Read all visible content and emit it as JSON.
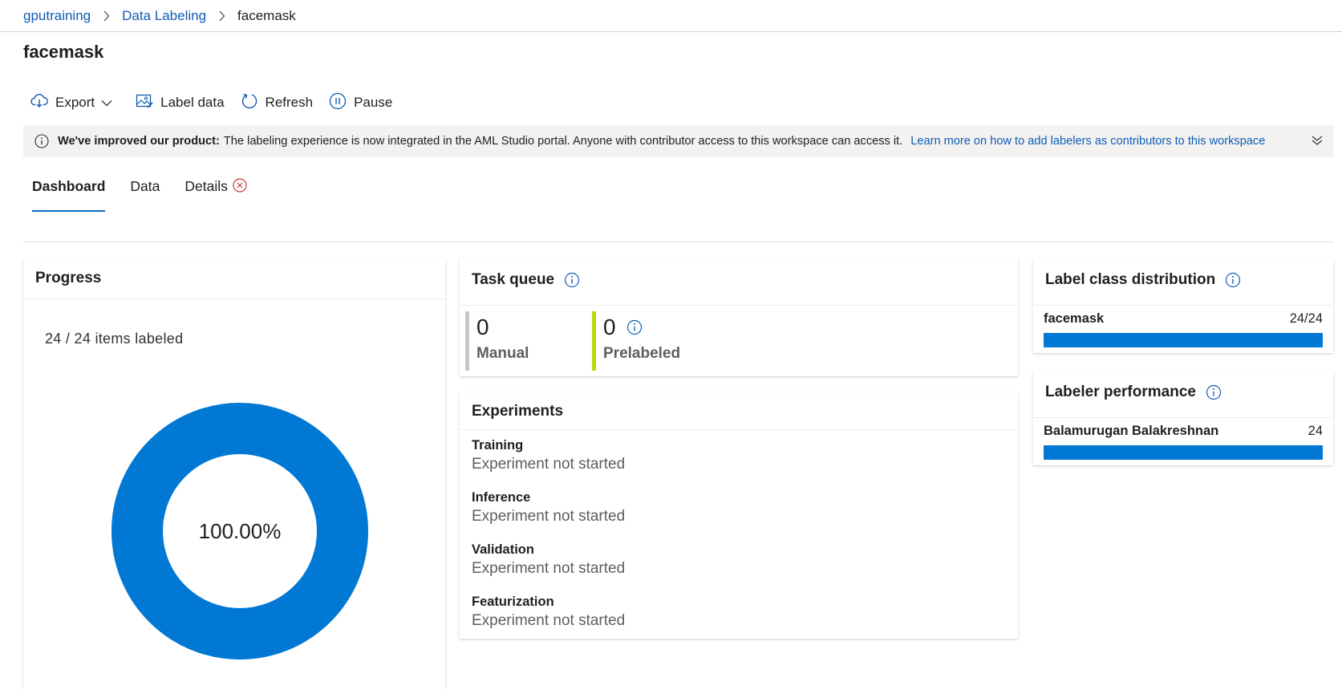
{
  "breadcrumb": {
    "items": [
      "gputraining",
      "Data Labeling"
    ],
    "current": "facemask"
  },
  "page": {
    "title": "facemask"
  },
  "toolbar": {
    "export": "Export",
    "label_data": "Label data",
    "refresh": "Refresh",
    "pause": "Pause"
  },
  "banner": {
    "bold": "We've improved our product:",
    "message": "The labeling experience is now integrated in the AML Studio portal. Anyone with contributor access to this workspace can access it.",
    "link": "Learn more on how to add labelers as contributors to this workspace"
  },
  "tabs": [
    "Dashboard",
    "Data",
    "Details"
  ],
  "progress": {
    "title": "Progress",
    "count_text": "24 / 24 items labeled",
    "percent_text": "100.00%",
    "fraction": 1.0,
    "color": "#0078d4"
  },
  "task_queue": {
    "title": "Task queue",
    "manual": {
      "value": "0",
      "label": "Manual",
      "color": "#c8c6c4"
    },
    "prelabeled": {
      "value": "0",
      "label": "Prelabeled",
      "color": "#bad80a"
    }
  },
  "experiments": {
    "title": "Experiments",
    "items": [
      {
        "name": "Training",
        "status": "Experiment not started"
      },
      {
        "name": "Inference",
        "status": "Experiment not started"
      },
      {
        "name": "Validation",
        "status": "Experiment not started"
      },
      {
        "name": "Featurization",
        "status": "Experiment not started"
      }
    ]
  },
  "label_class_distribution": {
    "title": "Label class distribution",
    "rows": [
      {
        "name": "facemask",
        "value": "24/24",
        "fraction": 1.0
      }
    ]
  },
  "labeler_performance": {
    "title": "Labeler performance",
    "rows": [
      {
        "name": "Balamurugan Balakreshnan",
        "value": "24",
        "fraction": 1.0
      }
    ]
  },
  "colors": {
    "accent": "#0078d4",
    "link": "#0f5cb5",
    "tab_underline": "#0f6cbd",
    "error": "#d13438"
  }
}
